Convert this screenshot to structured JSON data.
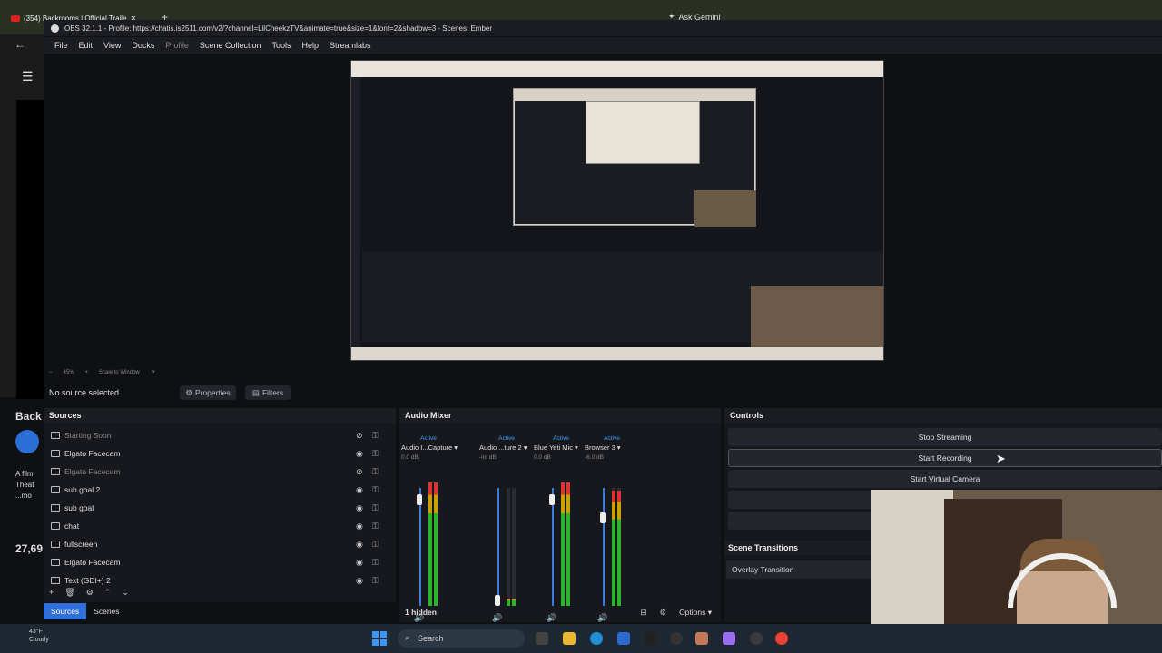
{
  "browser": {
    "tab_title": "(354) Backrooms | Official Traile",
    "gemini": "Ask Gemini",
    "left_texts": [
      "Back",
      "A film",
      "Theat",
      "...mo",
      "27,69"
    ]
  },
  "obs": {
    "title": "OBS 32.1.1 - Profile: https://chatis.is2511.com/v2/?channel=LilCheekzTV&animate=true&size=1&font=2&shadow=3 - Scenes: Ember",
    "menu": [
      "File",
      "Edit",
      "View",
      "Docks",
      "Profile",
      "Scene Collection",
      "Tools",
      "Help",
      "Streamlabs"
    ],
    "zoom": "45%",
    "scale_label": "Scale to Window",
    "no_source": "No source selected",
    "properties": "Properties",
    "filters": "Filters"
  },
  "sources": {
    "title": "Sources",
    "items": [
      {
        "label": "Starting Soon",
        "dim": true
      },
      {
        "label": "Elgato Facecam",
        "dim": false
      },
      {
        "label": "Elgato Facecam",
        "dim": true
      },
      {
        "label": "sub goal 2",
        "dim": false
      },
      {
        "label": "sub goal",
        "dim": false
      },
      {
        "label": "chat",
        "dim": false
      },
      {
        "label": "fullscreen",
        "dim": false
      },
      {
        "label": "Elgato Facecam",
        "dim": false
      },
      {
        "label": "Text (GDI+) 2",
        "dim": false
      }
    ]
  },
  "tabs": {
    "sources": "Sources",
    "scenes": "Scenes"
  },
  "mixer": {
    "title": "Audio Mixer",
    "channels": [
      {
        "active": "Active",
        "name": "Audio I...Capture",
        "db": "0.0 dB",
        "level": 0.9
      },
      {
        "active": "Active",
        "name": "Audio ...ture 2",
        "db": "-inf dB",
        "level": 0.05
      },
      {
        "active": "Active",
        "name": "Blue Yeti Mic",
        "db": "0.0 dB",
        "level": 0.9
      },
      {
        "active": "Active",
        "name": "Browser 3",
        "db": "-6.0 dB",
        "level": 0.75
      }
    ],
    "hidden": "1 hidden",
    "options": "Options"
  },
  "controls": {
    "title": "Controls",
    "stop_streaming": "Stop Streaming",
    "start_recording": "Start Recording",
    "start_virtual_camera": "Start Virtual Camera"
  },
  "transitions": {
    "title": "Scene Transitions",
    "selected": "Overlay Transition"
  },
  "taskbar": {
    "temp": "43°F",
    "weather": "Cloudy",
    "search": "Search"
  }
}
